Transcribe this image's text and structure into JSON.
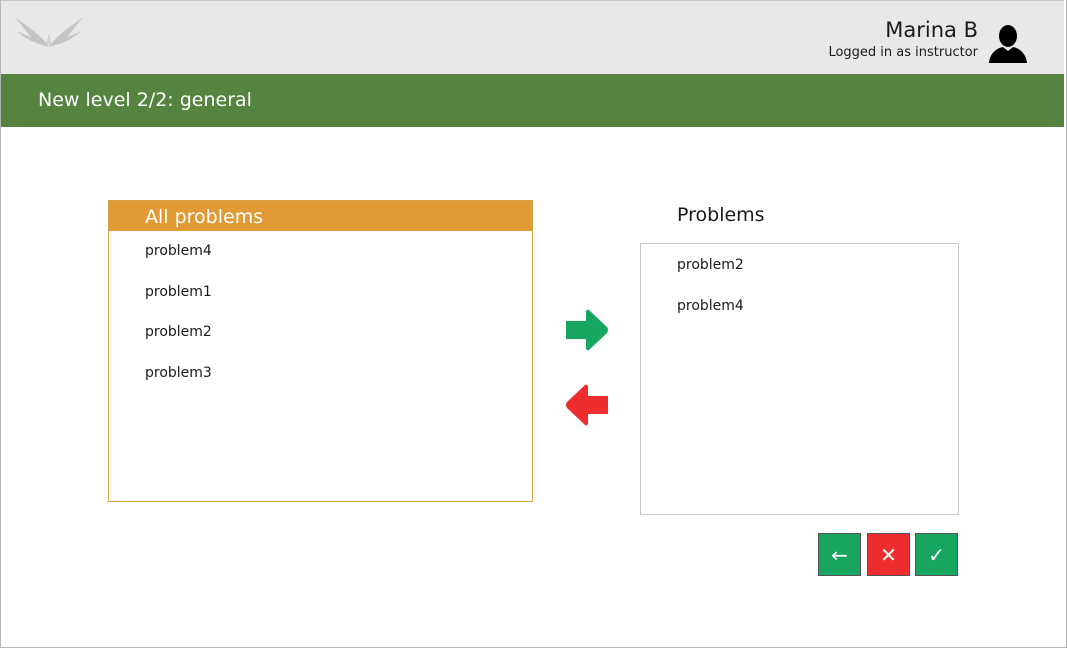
{
  "header": {
    "user_name": "Marina B",
    "user_role": "Logged in as instructor",
    "logo_icon": "winged-logo-icon",
    "avatar_icon": "user-silhouette-icon"
  },
  "titlebar": {
    "title": "New level 2/2: general"
  },
  "all_problems": {
    "heading": "All problems",
    "items": [
      "problem4",
      "problem1",
      "problem2",
      "problem3"
    ]
  },
  "selected_problems": {
    "heading": "Problems",
    "items": [
      "problem2",
      "problem4"
    ]
  },
  "transfer": {
    "add_icon": "arrow-right-icon",
    "remove_icon": "arrow-left-icon"
  },
  "actions": {
    "back_label": "←",
    "cancel_label": "✕",
    "confirm_label": "✓"
  },
  "colors": {
    "titlebar": "#558340",
    "list_header": "#e09a36",
    "add_green": "#17a65f",
    "remove_red": "#ee2d2f"
  }
}
